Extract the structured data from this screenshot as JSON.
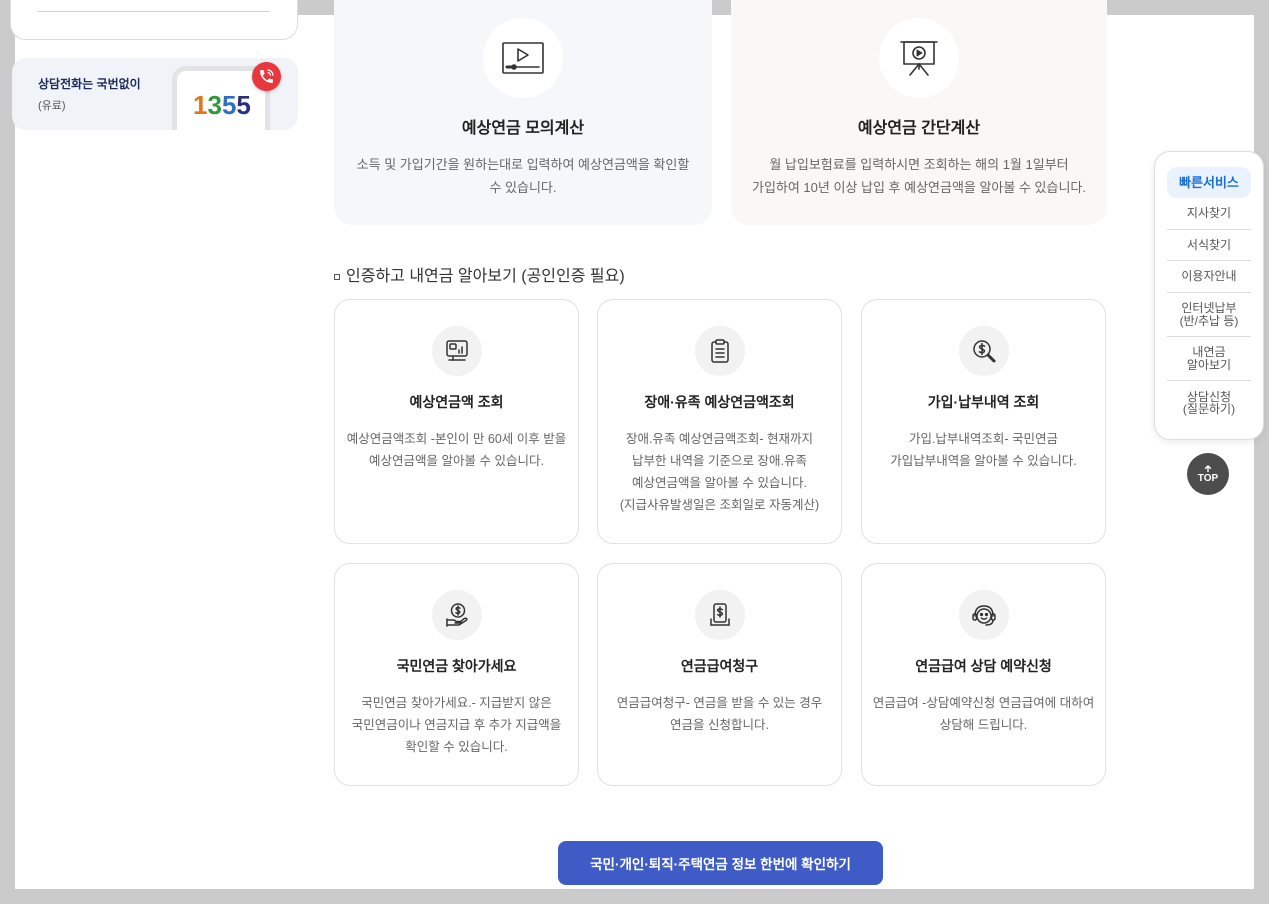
{
  "sidebar": {
    "call_center": {
      "title": "상담전화는 국번없이",
      "note": "(유료)",
      "number_digits": [
        {
          "digit": "1",
          "color": "#e8731a"
        },
        {
          "digit": "3",
          "color": "#2e9a3e"
        },
        {
          "digit": "5",
          "color": "#2f6fc0"
        },
        {
          "digit": "5",
          "color": "#2b2f7e"
        }
      ],
      "badge_icon": "phone-call-icon",
      "badge_color": "#e8383d"
    }
  },
  "calculators": [
    {
      "icon": "video-monitor-icon",
      "title": "예상연금 모의계산",
      "description": "소득 및 가입기간을 원하는대로 입력하여 예상연금액을 확인할\n수 있습니다.",
      "background": "#f5f7fa"
    },
    {
      "icon": "presentation-play-icon",
      "title": "예상연금 간단계산",
      "description": "월 납입보험료를 입력하시면 조회하는 해의 1월 1일부터\n가입하여 10년 이상 납입 후 예상연금액을 알아볼 수 있습니다.",
      "background": "#faf8f6"
    }
  ],
  "section": {
    "bullet_icon": "square-bullet-icon",
    "title": "인증하고 내연금 알아보기 (공인인증 필요)"
  },
  "service_cards": [
    {
      "icon": "monitor-chart-icon",
      "title": "예상연금액 조회",
      "description": "예상연금액조회 -본인이 만 60세 이후 받을\n예상연금액을 알아볼 수 있습니다."
    },
    {
      "icon": "clipboard-icon",
      "title": "장애·유족 예상연금액조회",
      "description": "장애.유족 예상연금액조회- 현재까지\n납부한 내역을 기준으로 장애.유족\n예상연금액을 알아볼 수 있습니다.\n(지급사유발생일은 조회일로 자동계산)"
    },
    {
      "icon": "search-dollar-icon",
      "title": "가입·납부내역 조회",
      "description": "가입.납부내역조회- 국민연금\n가입납부내역을 알아볼 수 있습니다."
    },
    {
      "icon": "hand-coin-icon",
      "title": "국민연금 찾아가세요",
      "description": "국민연금 찾아가세요.- 지급받지 않은\n국민연금이나 연금지급 후 추가 지급액을\n확인할 수 있습니다."
    },
    {
      "icon": "document-dollar-icon",
      "title": "연금급여청구",
      "description": "연금급여청구- 연금을 받을 수 있는 경우\n연금을 신청합니다."
    },
    {
      "icon": "headset-icon",
      "title": "연금급여 상담 예약신청",
      "description": "연금급여 -상담예약신청 연금급여에 대하여\n상담해 드립니다."
    }
  ],
  "quick_menu": {
    "title": "빠른서비스",
    "items": [
      "지사찾기",
      "서식찾기",
      "이용자안내",
      "인터넷납부\n(반/추납 등)",
      "내연금\n알아보기",
      "상담신청\n(질문하기)"
    ],
    "title_color": "#1a6fd1"
  },
  "top_button": {
    "icon": "arrow-up-icon",
    "label": "TOP",
    "color": "#4d4d4d"
  },
  "cta_button": {
    "label": "국민·개인·퇴직·주택연금 정보 한번에 확인하기",
    "color": "#3f5bc6"
  }
}
